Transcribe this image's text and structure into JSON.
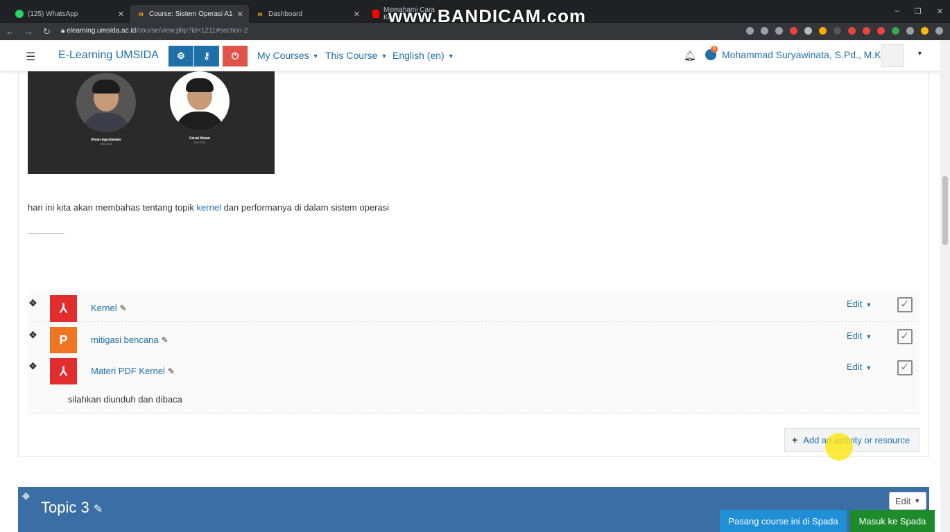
{
  "browser": {
    "tabs": [
      {
        "label": "(125) WhatsApp",
        "fav_color": "#25d366"
      },
      {
        "label": "Course: Sistem Operasi A1",
        "fav_color": "#f5a623",
        "active": true
      },
      {
        "label": "Dashboard",
        "fav_color": "#f5a623"
      },
      {
        "label": "Memahami Cara Ke",
        "fav_color": "#ff0000"
      }
    ],
    "watermark": "www.BANDICAM.com",
    "url_host": "elearning.umsida.ac.id",
    "url_path": "/course/view.php?id=1211#section-2"
  },
  "navbar": {
    "brand": "E-Learning UMSIDA",
    "menus": [
      "My Courses",
      "This Course",
      "English (en)"
    ],
    "message_badge": "6",
    "username": "Mohammad Suryawinata, S.Pd., M.Kom"
  },
  "section": {
    "people": [
      {
        "name": "Rivan Agustiawan",
        "id": "10517001"
      },
      {
        "name": "Faizal Alwan",
        "id": "10517041"
      }
    ],
    "summary_before": "hari ini kita akan membahas tentang topik ",
    "summary_link": "kernel",
    "summary_after": " dan performanya di dalam sistem operasi",
    "dots": "...................................",
    "activities": [
      {
        "name": "Kernel",
        "type": "pdf",
        "edit_label": "Edit"
      },
      {
        "name": "mitigasi bencana",
        "type": "ppt",
        "edit_label": "Edit"
      },
      {
        "name": "Materi PDF Kernel",
        "type": "pdf",
        "edit_label": "Edit"
      }
    ],
    "activity_description": "silahkan diunduh dan dibaca",
    "add_activity_label": "Add an activity or resource"
  },
  "next_topic": {
    "title": "Topic 3",
    "edit_label": "Edit"
  },
  "footer_buttons": {
    "spada_install": "Pasang course ini di Spada",
    "spada_login": "Masuk ke Spada"
  },
  "colors": {
    "accent": "#1f6fa8",
    "pdf_red": "#e12d2d",
    "ppt_orange": "#ee7623",
    "topic_header": "#3b6ea5"
  }
}
